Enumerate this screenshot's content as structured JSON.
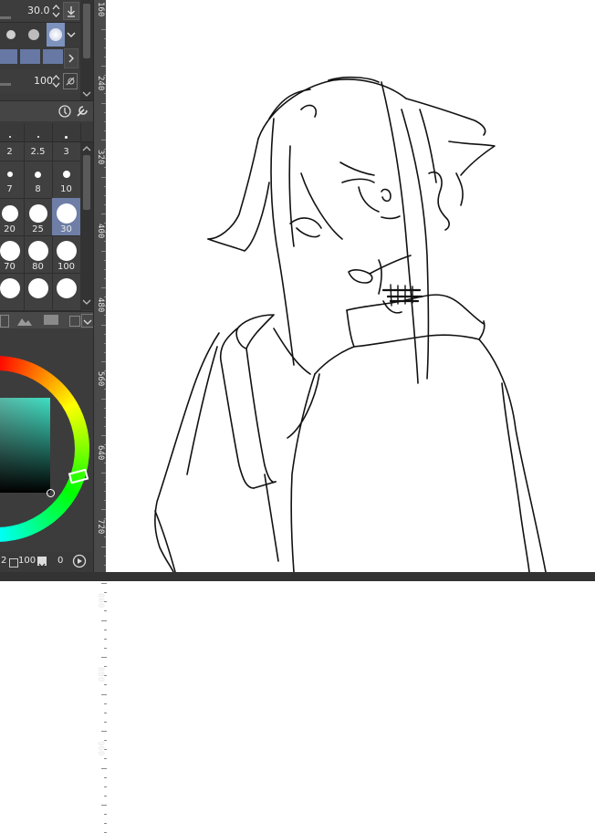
{
  "tool_property": {
    "size_value": "30.0",
    "opacity_value": "100"
  },
  "brush_size_grid": {
    "rows": [
      [
        "2",
        "2.5",
        "3"
      ],
      [
        "7",
        "8",
        "10"
      ],
      [
        "20",
        "25",
        "30"
      ],
      [
        "70",
        "80",
        "100"
      ],
      [
        "",
        "",
        ""
      ]
    ],
    "selected": "30"
  },
  "ruler": {
    "labels": [
      "160",
      "240",
      "320",
      "400",
      "480",
      "560",
      "640",
      "720",
      "800",
      "880",
      "960"
    ]
  },
  "color_panel": {
    "status_text": "2",
    "zoom_text": "100",
    "value_text": "0"
  },
  "icons": {
    "size_stepper": "stepper-icon",
    "download": "download-arrow-icon",
    "dropdown": "chevron-down-icon",
    "next": "chevron-right-icon",
    "opacity_stepper": "stepper-icon",
    "link": "link-icon",
    "settings": "settings-icon",
    "wrench": "wrench-icon",
    "play": "play-circle-icon"
  }
}
